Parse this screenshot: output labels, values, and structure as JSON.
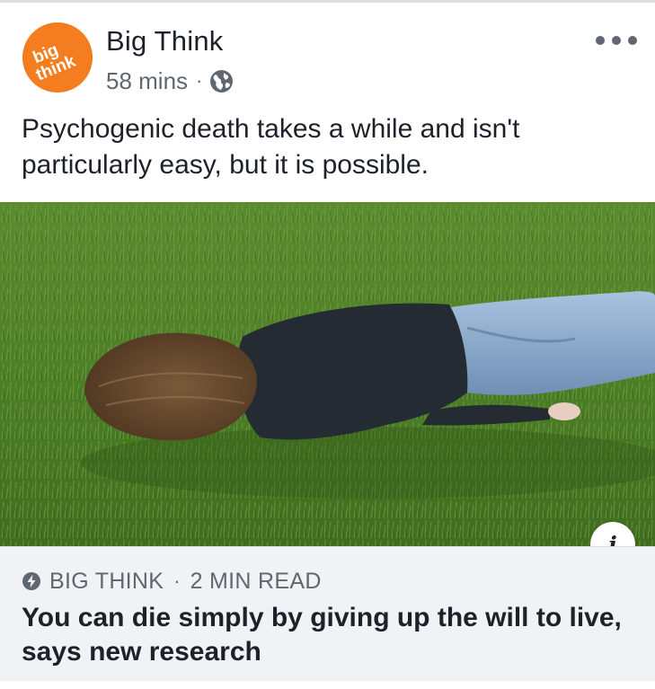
{
  "post": {
    "page_name": "Big Think",
    "avatar_text_line1": "big",
    "avatar_text_line2": "think",
    "time": "58 mins",
    "separator": "·",
    "privacy_icon": "globe-icon",
    "more_icon": "ellipsis-icon",
    "text": "Psychogenic death takes a while and isn't particularly easy, but it is possible."
  },
  "link_preview": {
    "source": "BIG THINK",
    "separator": "·",
    "read_time": "2 MIN READ",
    "title": "You can die simply by giving up the will to live, says new research",
    "info_label": "i"
  },
  "colors": {
    "brand_orange": "#f47d20",
    "text": "#1d2129",
    "secondary_text": "#606770",
    "link_box_bg": "#f1f2f5"
  }
}
